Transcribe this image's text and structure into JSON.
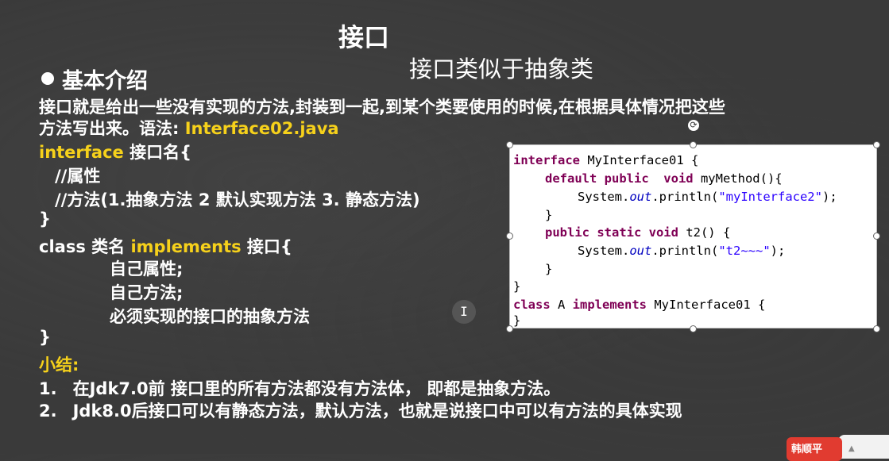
{
  "slide": {
    "title": "接口",
    "subtitle": "接口类似于抽象类",
    "section_heading": "基本介绍"
  },
  "intro": {
    "line1": "接口就是给出一些没有实现的方法,封装到一起,到某个类要使用的时候,在根据具体情况把这些",
    "line2_prefix": "方法写出来。语法: ",
    "line2_file": "Interface02.java"
  },
  "syntax": {
    "interface_kw": "interface",
    "interface_rest": " 接口名{",
    "attr_comment": "//属性",
    "method_comment": "//方法(1.抽象方法 2 默认实现方法 3. 静态方法)",
    "close1": "}",
    "class_prefix": "class 类名 ",
    "implements_kw": "implements",
    "class_suffix": " 接口{",
    "own_attrs": "自己属性;",
    "own_methods": "自己方法;",
    "must_impl": "必须实现的接口的抽象方法",
    "close2": "}"
  },
  "summary": {
    "heading": "小结:",
    "item1_num": "1.",
    "item1_text": "在Jdk7.0前 接口里的所有方法都没有方法体， 即都是抽象方法。",
    "item2_num": "2.",
    "item2_text": "Jdk8.0后接口可以有静态方法，默认方法，也就是说接口中可以有方法的具体实现"
  },
  "code": {
    "l1_kw": "interface",
    "l1_rest": " MyInterface01 {",
    "l2_kw": "default public  void",
    "l2_rest": " myMethod(){",
    "l3_a": "System.",
    "l3_out": "out",
    "l3_b": ".println(",
    "l3_str": "\"myInterface2\"",
    "l3_c": ");",
    "l4": "}",
    "l5_kw": "public static void",
    "l5_rest": " t2() {",
    "l6_a": "System.",
    "l6_out": "out",
    "l6_b": ".println(",
    "l6_str": "\"t2~~~\"",
    "l6_c": ");",
    "l7": "}",
    "l8": "}",
    "l9_kw1": "class",
    "l9_mid": " A ",
    "l9_kw2": "implements",
    "l9_rest": " MyInterface01 {",
    "l10": "}"
  },
  "ui": {
    "rotate_icon": "rotate-icon",
    "cursor_glyph": "I",
    "badge_text": "韩顺平",
    "arrow_glyph": "▲"
  },
  "colors": {
    "highlight": "#f6d11b",
    "background": "#3a3a3a",
    "code_keyword": "#7f0055",
    "code_string": "#2a00ff"
  }
}
